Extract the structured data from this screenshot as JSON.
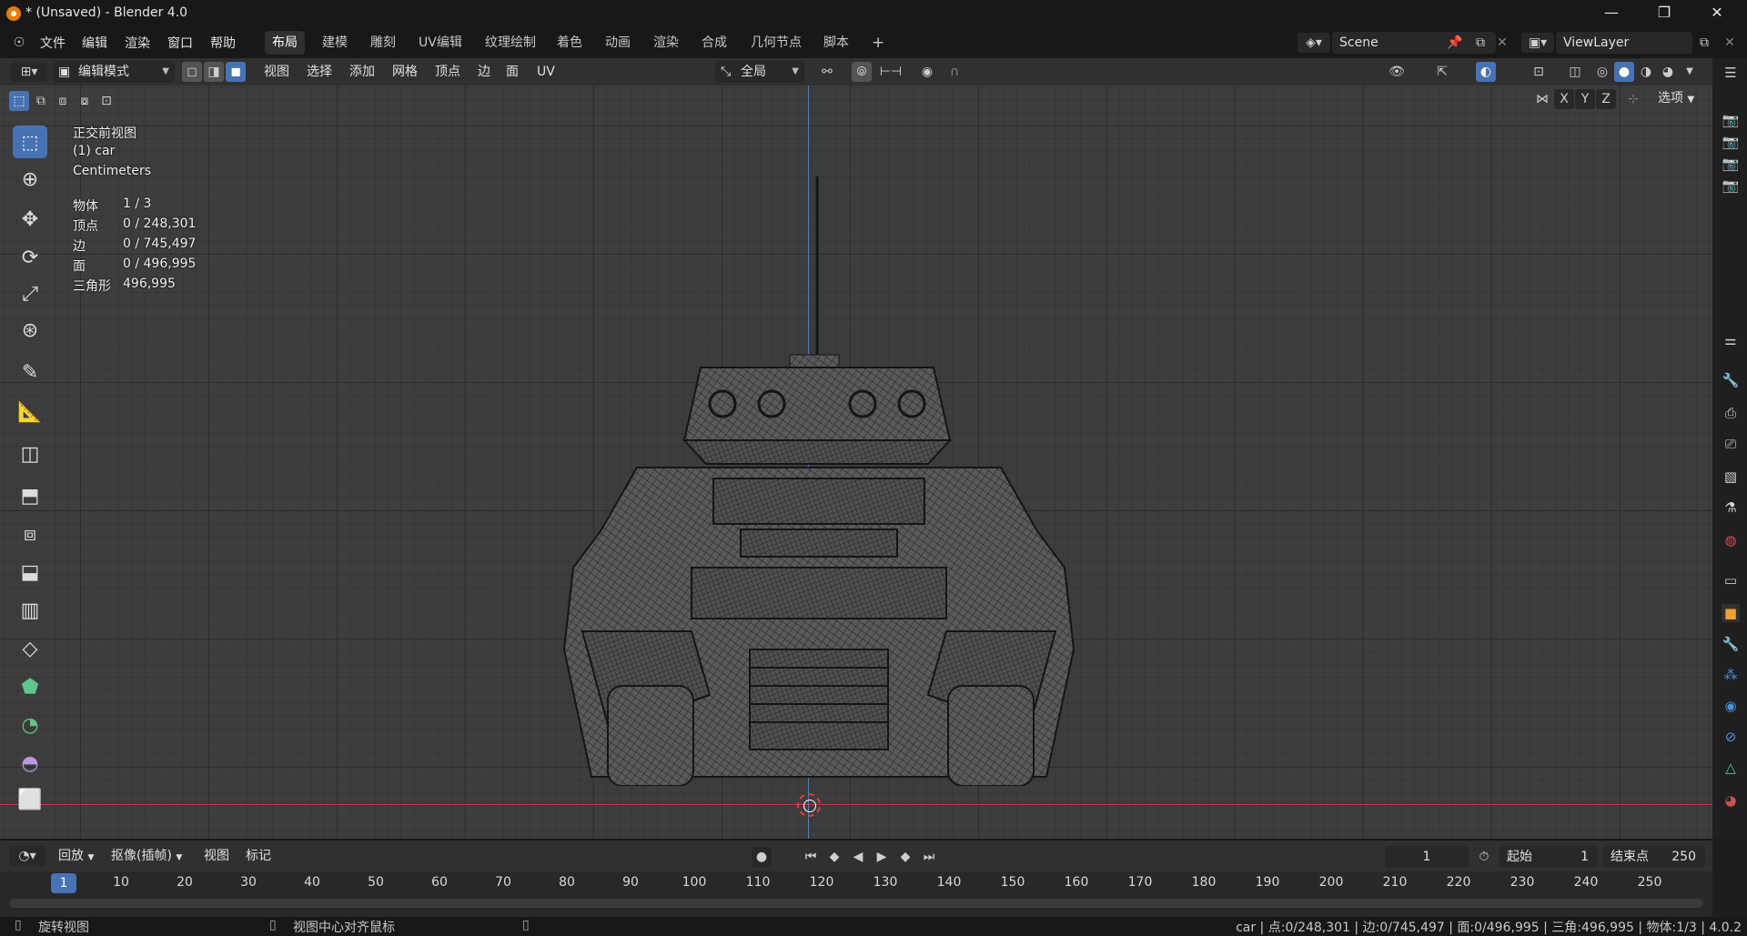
{
  "window": {
    "title": "* (Unsaved) - Blender 4.0",
    "controls": [
      "—",
      "❐",
      "✕"
    ]
  },
  "menu": {
    "items": [
      "文件",
      "编辑",
      "渲染",
      "窗口",
      "帮助"
    ]
  },
  "workspaces": {
    "tabs": [
      "布局",
      "建模",
      "雕刻",
      "UV编辑",
      "纹理绘制",
      "着色",
      "动画",
      "渲染",
      "合成",
      "几何节点",
      "脚本"
    ],
    "active": "布局",
    "add": "+"
  },
  "scene": {
    "name": "Scene",
    "view_layer": "ViewLayer"
  },
  "viewport_header": {
    "mode": "编辑模式",
    "menus": [
      "视图",
      "选择",
      "添加",
      "网格",
      "顶点",
      "边",
      "面",
      "UV"
    ],
    "transform_orientation": "全局",
    "axes": [
      "X",
      "Y",
      "Z"
    ],
    "options": "选项"
  },
  "overlay": {
    "view_name": "正交前视图",
    "object": "(1) car",
    "units": "Centimeters",
    "stats": [
      {
        "label": "物体",
        "value": "1 / 3"
      },
      {
        "label": "顶点",
        "value": "0 / 248,301"
      },
      {
        "label": "边",
        "value": "0 / 745,497"
      },
      {
        "label": "面",
        "value": "0 / 496,995"
      },
      {
        "label": "三角形",
        "value": "496,995"
      }
    ]
  },
  "timeline_header": {
    "playback": "回放",
    "keying": "抠像(插帧)",
    "view": "视图",
    "marker": "标记",
    "current_frame": "1",
    "start_label": "起始",
    "start": "1",
    "end_label": "结束点",
    "end": "250"
  },
  "timeline": {
    "ticks": [
      "10",
      "20",
      "30",
      "40",
      "50",
      "60",
      "70",
      "80",
      "90",
      "100",
      "110",
      "120",
      "130",
      "140",
      "150",
      "160",
      "170",
      "180",
      "190",
      "200",
      "210",
      "220",
      "230",
      "240",
      "250"
    ],
    "playhead": "1"
  },
  "statusbar": {
    "left_hint": "旋转视图",
    "middle_hint": "视图中心对齐鼠标",
    "stats": "car | 点:0/248,301 | 边:0/745,497 | 面:0/496,995 | 三角:496,995 | 物体:1/3 | 4.0.2"
  },
  "colors": {
    "accent": "#4772b3",
    "x_axis": "#c04040",
    "z_axis": "#4a7ed0",
    "logo": "#e87d0d"
  }
}
